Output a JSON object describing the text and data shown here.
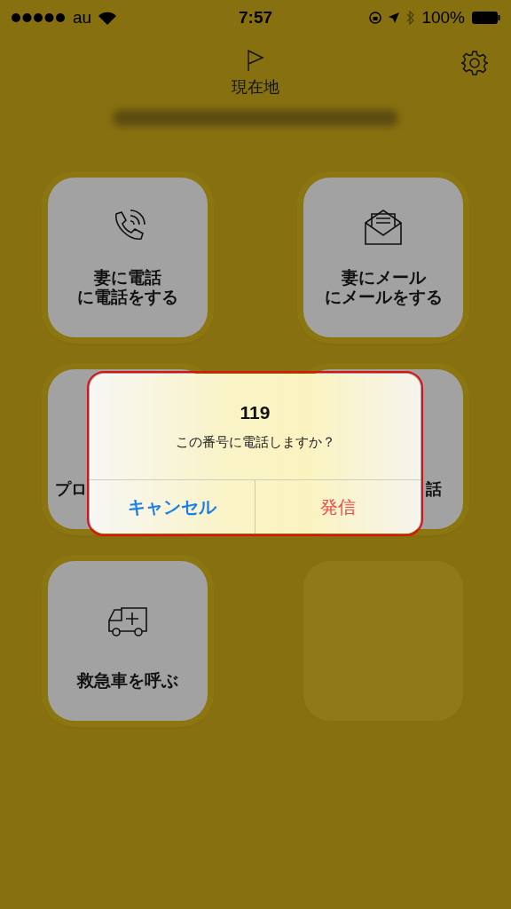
{
  "status_bar": {
    "carrier": "au",
    "time": "7:57",
    "battery": "100%"
  },
  "header": {
    "title": "現在地"
  },
  "tiles": [
    {
      "kind": "phone",
      "lines": [
        "妻に電話",
        "に電話をする"
      ]
    },
    {
      "kind": "mail",
      "lines": [
        "妻にメール",
        "にメールをする"
      ]
    },
    {
      "kind": "left",
      "lines": [
        "プロ"
      ]
    },
    {
      "kind": "right",
      "lines": [
        "話"
      ]
    },
    {
      "kind": "ambulance",
      "lines": [
        "救急車を呼ぶ"
      ]
    },
    {
      "kind": "empty"
    }
  ],
  "dialog": {
    "title": "119",
    "message": "この番号に電話しますか？",
    "buttons": [
      {
        "label": "キャンセル",
        "kind": "cancel"
      },
      {
        "label": "発信",
        "kind": "destructive"
      }
    ]
  }
}
